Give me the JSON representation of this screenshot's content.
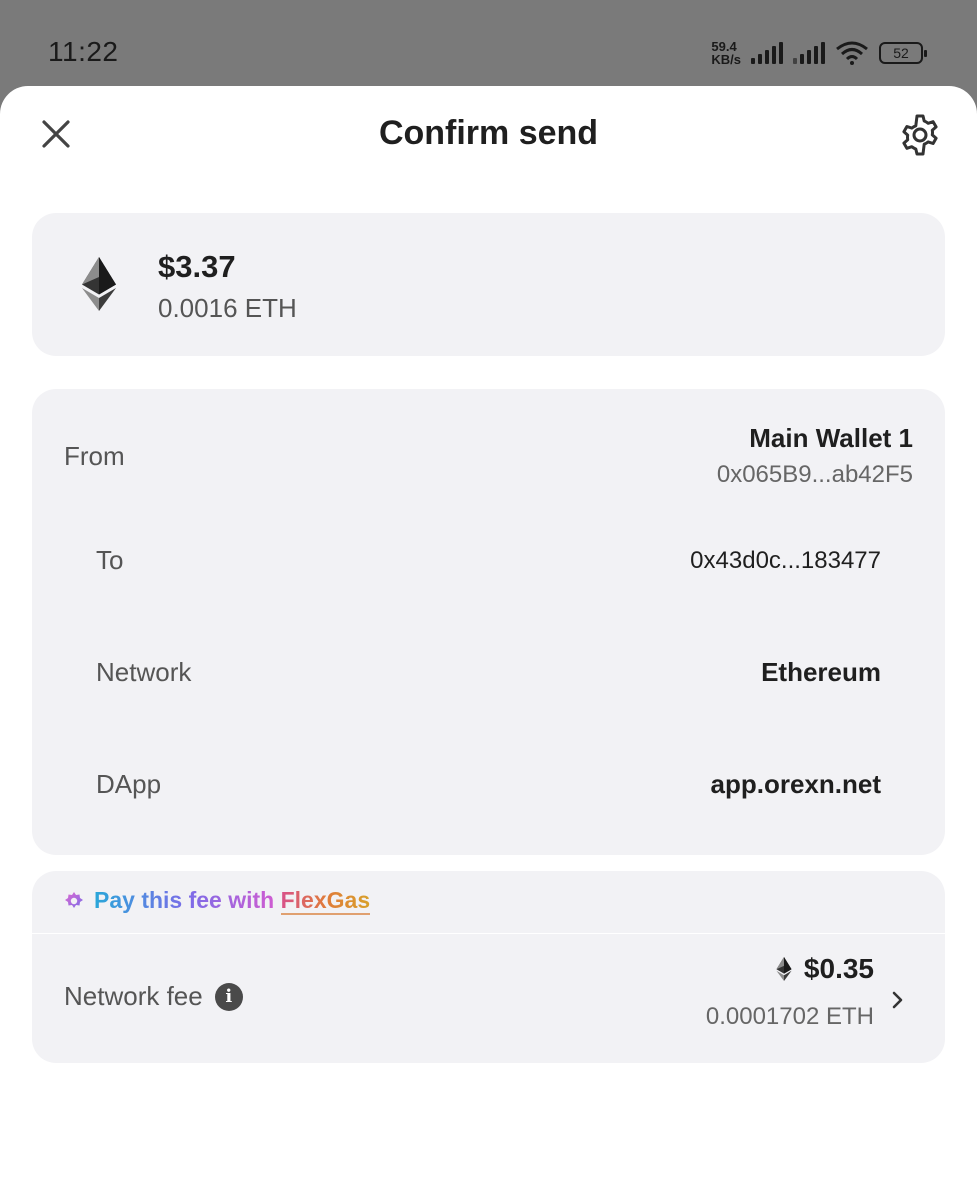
{
  "status_bar": {
    "time": "11:22",
    "net_speed_value": "59.4",
    "net_speed_unit": "KB/s",
    "battery": "52",
    "icons": [
      "signal-icon",
      "signal-icon",
      "wifi-icon",
      "battery-icon"
    ]
  },
  "header": {
    "title": "Confirm send",
    "close_icon": "close-icon",
    "settings_icon": "gear-icon"
  },
  "amount": {
    "usd": "$3.37",
    "eth": "0.0016 ETH",
    "icon": "ethereum-icon"
  },
  "details": {
    "from_label": "From",
    "from_wallet": "Main Wallet 1",
    "from_address": "0x065B9...ab42F5",
    "to_label": "To",
    "to_address": "0x43d0c...183477",
    "network_label": "Network",
    "network_value": "Ethereum",
    "dapp_label": "DApp",
    "dapp_value": "app.orexn.net"
  },
  "fee": {
    "flexgas_prefix": "Pay this fee with ",
    "flexgas_link": "FlexGas",
    "label": "Network fee",
    "info_icon": "info-icon",
    "usd": "$0.35",
    "eth": "0.0001702 ETH",
    "chevron_icon": "chevron-right-icon"
  },
  "colors": {
    "card_bg": "#f2f2f5",
    "backdrop": "#7a7a7a",
    "text_primary": "#1f1f1f",
    "text_secondary": "#555555"
  }
}
